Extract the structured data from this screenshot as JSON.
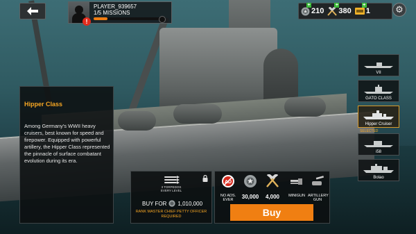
{
  "topbar": {
    "back_icon": "arrow-left-icon",
    "player_name": "PLAYER_939657",
    "missions_text": "1/5 MISSIONS",
    "missions_progress": 0.2,
    "alert_text": "!"
  },
  "currencies": [
    {
      "icon": "medal-icon",
      "value": "210"
    },
    {
      "icon": "hammers-icon",
      "value": "380"
    },
    {
      "icon": "ticket-icon",
      "value": "1"
    }
  ],
  "info": {
    "title": "Hipper Class",
    "description": "Among Germany's WWII heavy cruisers, best known for speed and firepower. Equipped with powerful artillery, the Hipper Class represented the pinnacle of surface combatant evolution during its era."
  },
  "ships": [
    {
      "label": "VII",
      "selected": false
    },
    {
      "label": "GATO CLASS",
      "selected": false
    },
    {
      "label": "Hipper Cruiser",
      "selected": true,
      "status": "SELECTED"
    },
    {
      "label": "i58",
      "selected": false
    },
    {
      "label": "Bolao",
      "selected": false
    }
  ],
  "buy_panel": {
    "torpedo_caption_1": "3 TORPEDOS",
    "torpedo_caption_2": "EVERY LEVEL",
    "buy_for_label": "BUY FOR",
    "price": "1,010,000",
    "rank_requirement_1": "RANK MASTER CHIEF PETTY OFFICER",
    "rank_requirement_2": "REQUIRED"
  },
  "pack": {
    "items": [
      {
        "icon": "no-ads-icon",
        "label": "NO ADS. EVER",
        "value": ""
      },
      {
        "icon": "medal-icon",
        "label": "",
        "value": "30,000"
      },
      {
        "icon": "hammers-icon",
        "label": "",
        "value": "4,000"
      },
      {
        "icon": "minigun-icon",
        "label": "MINIGUN",
        "value": ""
      },
      {
        "icon": "artillery-icon",
        "label": "ARTILLERY GUN",
        "value": ""
      }
    ],
    "buy_label": "Buy"
  },
  "colors": {
    "accent_orange": "#f07f12",
    "title_orange": "#f6a623",
    "alert_red": "#e22c1d",
    "plus_green": "#3dbb3b"
  }
}
